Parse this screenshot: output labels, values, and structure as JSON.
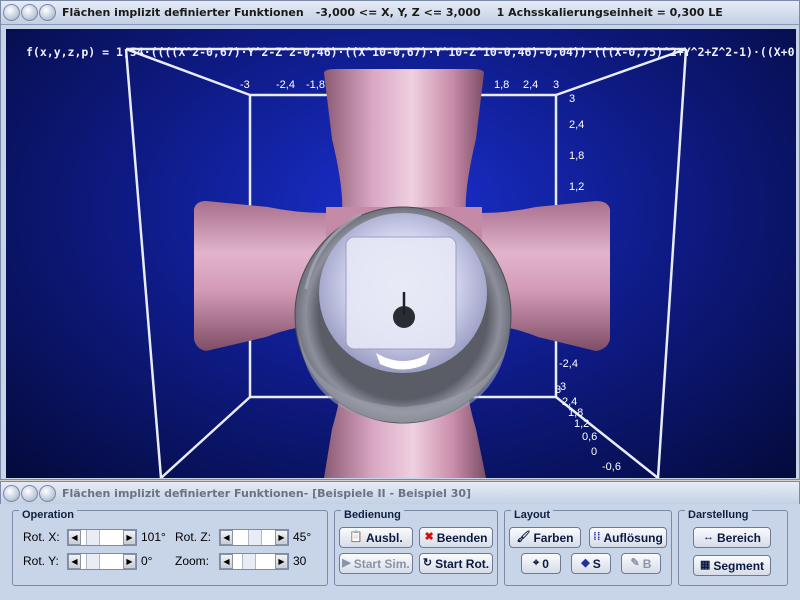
{
  "main_window": {
    "title": "Flächen implizit definierter Funktionen",
    "range": "-3,000 <= X, Y, Z <= 3,000",
    "scale": "1 Achsskalierungseinheit = 0,300 LE"
  },
  "plot": {
    "formula": "f(x,y,z,p) = 1,54·((((X^2-0,67)·Y^2-Z^2-0,46)·((X^10-0,67)·Y^10-Z^10-0,46)-0,04))·(((X-0,75)^2+Y^2+Z^2-1)·((X+0,",
    "top_ticks": [
      "-3",
      "-2,4",
      "-1,8",
      "1,8",
      "2,4",
      "3"
    ],
    "right_ticks": [
      "3",
      "2,4",
      "1,8",
      "1,2",
      "-2,4",
      "3"
    ],
    "bottom_ticks": [
      "3",
      "2,4",
      "1,8",
      "1,2",
      "0,6",
      "0",
      "-0,6"
    ]
  },
  "control_window": {
    "title": "Flächen implizit definierter Funktionen",
    "subtitle": " - [Beispiele II - Beispiel 30]"
  },
  "operation": {
    "title": "Operation",
    "rot_x_label": "Rot. X:",
    "rot_x_value": "101°",
    "rot_y_label": "Rot. Y:",
    "rot_y_value": "0°",
    "rot_z_label": "Rot. Z:",
    "rot_z_value": "45°",
    "zoom_label": "Zoom:",
    "zoom_value": "30"
  },
  "bedienung": {
    "title": "Bedienung",
    "ausbl": "Ausbl.",
    "beenden": "Beenden",
    "start_sim": "Start Sim.",
    "start_rot": "Start Rot."
  },
  "layout": {
    "title": "Layout",
    "farben": "Farben",
    "aufloesung": "Auflösung",
    "zero": "0",
    "s": "S",
    "b": "B"
  },
  "darstellung": {
    "title": "Darstellung",
    "bereich": "Bereich",
    "segment": "Segment"
  },
  "colors": {
    "surface": "#d9a6c2",
    "ring": "#7c7f8a",
    "background": "#0f1c8a"
  }
}
